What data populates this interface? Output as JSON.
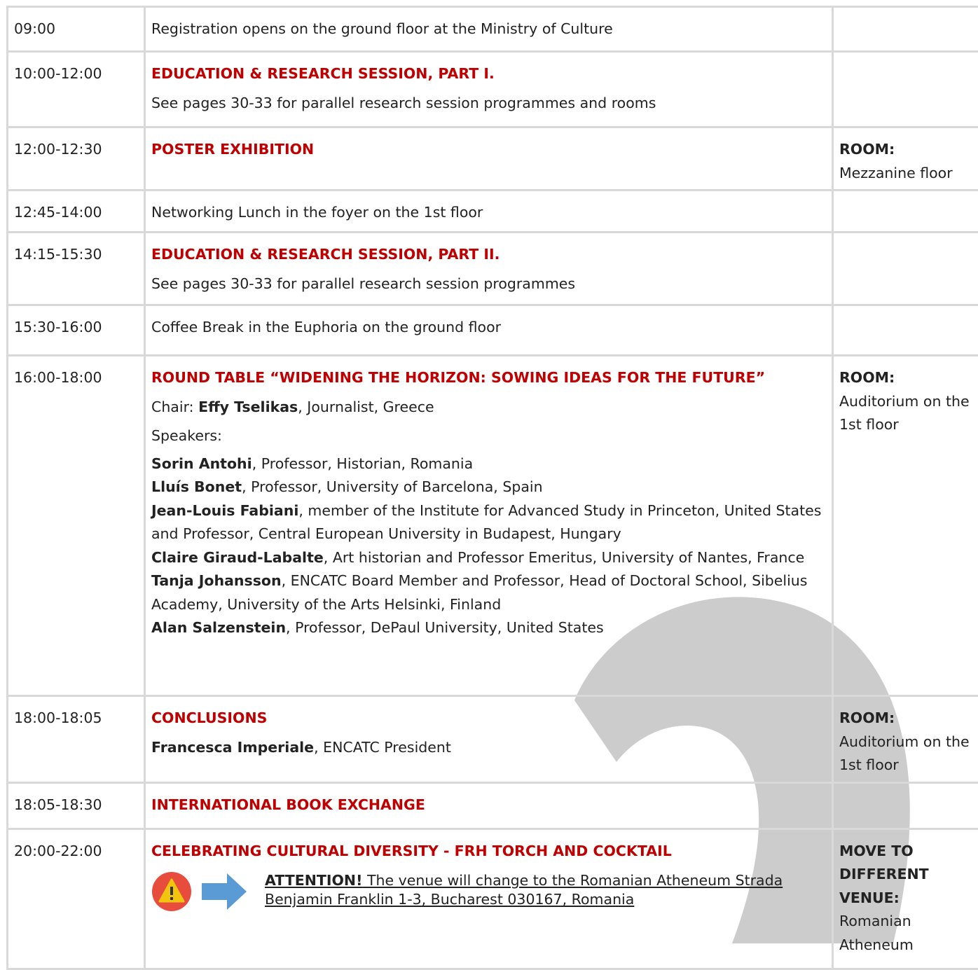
{
  "rows": [
    {
      "time": "09:00",
      "text": "Registration opens on the ground floor at the Ministry of Culture"
    },
    {
      "time": "10:00-12:00",
      "title": "EDUCATION & RESEARCH SESSION, PART I.",
      "text": "See pages 30-33 for parallel research session programmes and rooms"
    },
    {
      "time": "12:00-12:30",
      "title": "POSTER EXHIBITION",
      "room_label": "ROOM:",
      "room": "Mezzanine floor"
    },
    {
      "time": "12:45-14:00",
      "text": "Networking Lunch in the foyer on the 1st floor"
    },
    {
      "time": "14:15-15:30",
      "title": "EDUCATION & RESEARCH SESSION, PART II.",
      "text": "See pages 30-33 for parallel research session programmes"
    },
    {
      "time": "15:30-16:00",
      "text": "Coffee Break in the Euphoria on the  ground floor"
    },
    {
      "time": "16:00-18:00",
      "title": "ROUND TABLE “WIDENING THE HORIZON: SOWING IDEAS FOR THE FUTURE”",
      "chair_prefix": "Chair: ",
      "chair_name": "Effy Tselikas",
      "chair_rest": ", Journalist, Greece",
      "speakers_label": "Speakers:",
      "speakers": [
        {
          "name": "Sorin Antohi",
          "desc": ", Professor, Historian, Romania"
        },
        {
          "name": "Lluís Bonet",
          "desc": ", Professor, University of Barcelona, Spain"
        },
        {
          "name": "Jean-Louis Fabiani",
          "desc": ", member of the Institute for Advanced Study in Princeton, United States and Professor, Central European University in Budapest, Hungary"
        },
        {
          "name": "Claire Giraud-Labalte",
          "desc": ", Art historian and Professor Emeritus, University of Nantes, France"
        },
        {
          "name": "Tanja Johansson",
          "desc": ", ENCATC Board Member and Professor, Head of Doctoral School, Sibelius Academy, University of the Arts Helsinki, Finland"
        },
        {
          "name": "Alan Salzenstein",
          "desc": ", Professor, DePaul University, United States"
        }
      ],
      "room_label": "ROOM:",
      "room": "Auditorium on the 1st floor"
    },
    {
      "time": "18:00-18:05",
      "title": "CONCLUSIONS",
      "person_name": "Francesca Imperiale",
      "person_rest": ", ENCATC President",
      "room_label": "ROOM:",
      "room": "Auditorium on the 1st floor"
    },
    {
      "time": "18:05-18:30",
      "title": "INTERNATIONAL BOOK EXCHANGE"
    },
    {
      "time": "20:00-22:00",
      "title": "CELEBRATING CULTURAL DIVERSITY - FRH TORCH AND COCKTAIL",
      "attention_label": "ATTENTION!",
      "attention_text": " The venue will change to the Romanian Atheneum Strada Benjamin Franklin 1-3, Bucharest 030167, Romania",
      "room_label": "MOVE TO DIFFERENT VENUE:",
      "room": "Romanian Atheneum"
    }
  ],
  "icons": {
    "warning": "warning-icon",
    "arrow": "arrow-right-icon"
  },
  "colors": {
    "accent": "#c00000",
    "border": "#d9d9d9",
    "warning_bg": "#e74c3c",
    "warning_fg": "#f1c40f",
    "arrow": "#5b9bd5",
    "watermark": "#cccccc"
  }
}
